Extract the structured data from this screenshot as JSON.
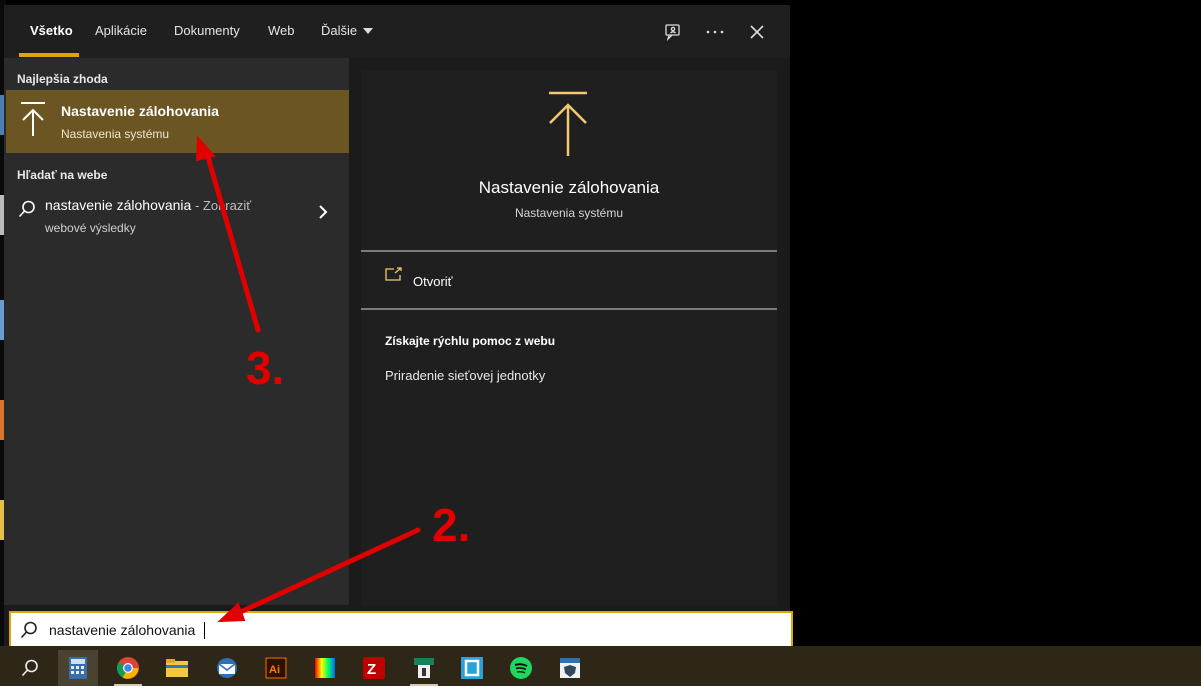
{
  "tabs": [
    {
      "label": "Všetko",
      "active": true
    },
    {
      "label": "Aplikácie"
    },
    {
      "label": "Dokumenty"
    },
    {
      "label": "Web"
    },
    {
      "label": "Ďalšie"
    }
  ],
  "top_icons": [
    "feedback-icon",
    "more-icon",
    "close-icon"
  ],
  "left": {
    "best_match_heading": "Najlepšia zhoda",
    "best_match": {
      "title": "Nastavenie zálohovania",
      "subtitle": "Nastavenia systému",
      "icon": "backup-arrow-up-icon"
    },
    "web_heading": "Hľadať na webe",
    "web_result": {
      "query": "nastavenie zálohovania",
      "suffix": " - Zobraziť",
      "line2": "webové výsledky"
    }
  },
  "right": {
    "title": "Nastavenie zálohovania",
    "subtitle": "Nastavenia systému",
    "open_label": "Otvoriť",
    "help_heading": "Získajte rýchlu pomoc z webu",
    "help_link": "Priradenie sieťovej jednotky"
  },
  "search": {
    "value": "nastavenie zálohovania"
  },
  "taskbar": [
    "search-icon",
    "calculator-icon",
    "chrome-icon",
    "file-explorer-icon",
    "mail-icon",
    "illustrator-icon",
    "color-app-icon",
    "filezilla-icon",
    "tool-app-icon",
    "frame-app-icon",
    "spotify-icon",
    "vpn-app-icon"
  ],
  "annotations": {
    "step2": "2.",
    "step3": "3."
  },
  "colors": {
    "accent": "#d8a90d",
    "best_match_bg": "#6b5522",
    "annotation": "#e00000"
  }
}
